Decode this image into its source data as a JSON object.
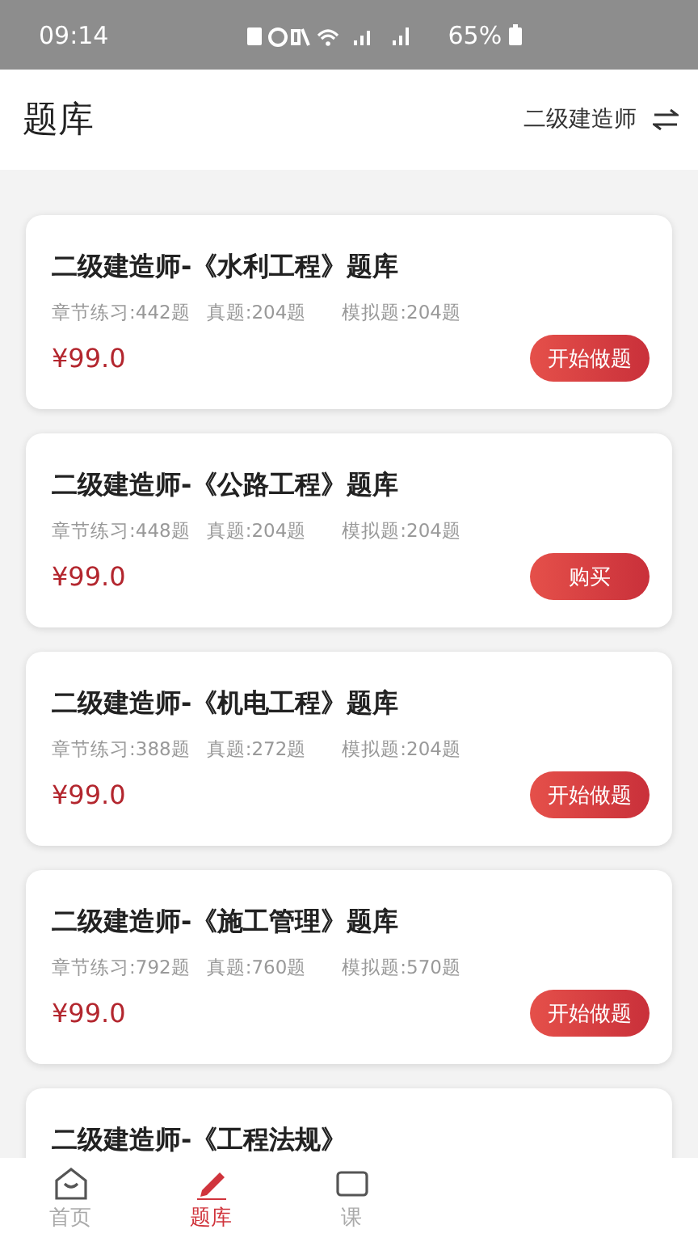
{
  "status_bar": {
    "time": "09:14",
    "battery": "65%"
  },
  "header": {
    "title": "题库",
    "category": "二级建造师"
  },
  "banks": [
    {
      "title": "二级建造师-《水利工程》题库",
      "stats": [
        "章节练习:442题",
        "真题:204题",
        "模拟题:204题"
      ],
      "price": "¥99.0",
      "action": "开始做题"
    },
    {
      "title": "二级建造师-《公路工程》题库",
      "stats": [
        "章节练习:448题",
        "真题:204题",
        "模拟题:204题"
      ],
      "price": "¥99.0",
      "action": "购买"
    },
    {
      "title": "二级建造师-《机电工程》题库",
      "stats": [
        "章节练习:388题",
        "真题:272题",
        "模拟题:204题"
      ],
      "price": "¥99.0",
      "action": "开始做题"
    },
    {
      "title": "二级建造师-《施工管理》题库",
      "stats": [
        "章节练习:792题",
        "真题:760题",
        "模拟题:570题"
      ],
      "price": "¥99.0",
      "action": "开始做题"
    },
    {
      "title": "二级建造师-《工程法规》"
    }
  ],
  "tab_bar": [
    {
      "label": "首页",
      "kind": "home",
      "selected": false
    },
    {
      "label": "题库",
      "kind": "pencil",
      "selected": true
    },
    {
      "label": "课",
      "kind": "screen",
      "selected": false
    }
  ]
}
